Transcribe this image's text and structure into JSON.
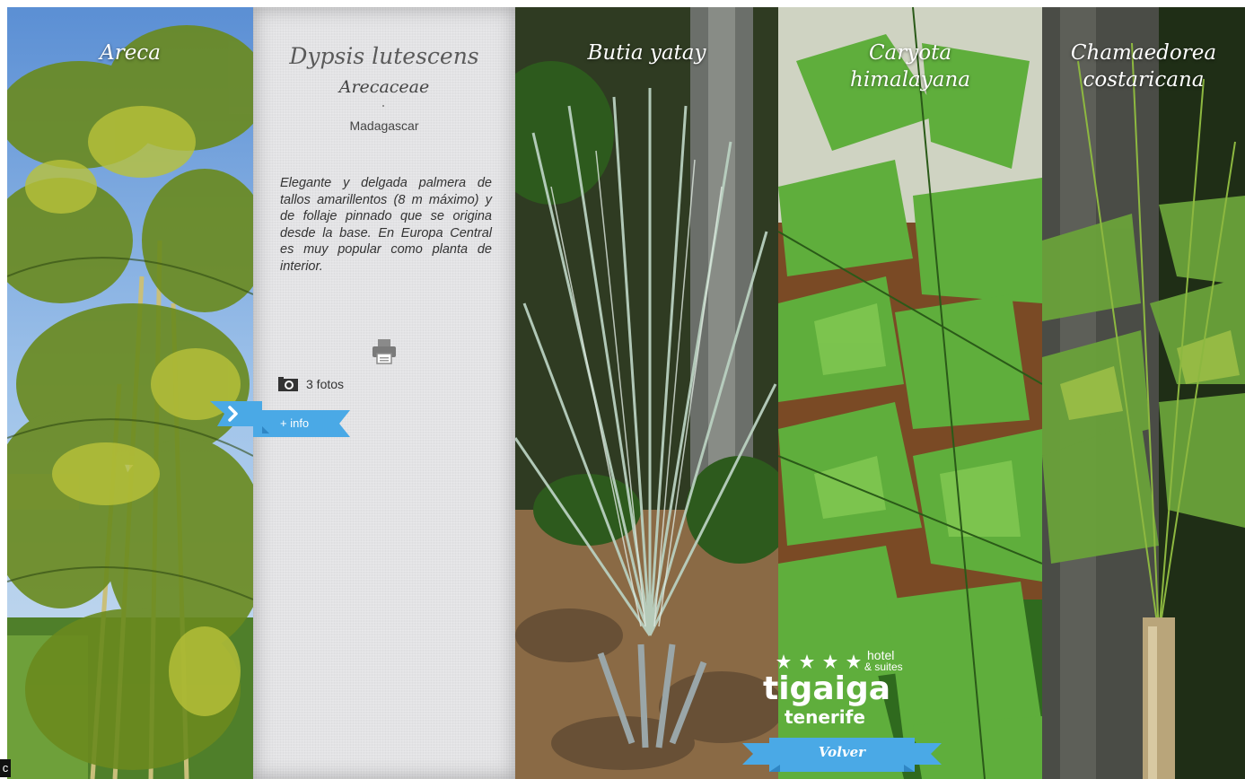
{
  "panels": [
    {
      "title": "Areca"
    },
    {
      "title": "Butia yatay"
    },
    {
      "title": "Caryota himalayana"
    },
    {
      "title": "Chamaedorea costaricana"
    }
  ],
  "card": {
    "scientific_name": "Dypsis lutescens",
    "family": "Arecaceae",
    "origin": "Madagascar",
    "description": "Elegante y delgada palmera de tallos amarillentos (8 m máximo) y de follaje pinnado que se origina desde la base. En Europa Central es muy popular como planta de interior.",
    "photos_count": "3 fotos",
    "more_info": "+ info"
  },
  "logo": {
    "text_hotel": "hotel",
    "text_suites": "& suites",
    "text_brand": "tigaiga",
    "text_place": "tenerife"
  },
  "volver_label": "Volver",
  "corner_label": "c",
  "icons": {
    "printer": "printer-icon",
    "camera": "camera-icon",
    "arrow": "chevron-right-icon"
  },
  "colors": {
    "ribbon": "#4aa9e6",
    "ribbon_dark": "#2f86c4",
    "card_bg": "#e3e3e5"
  }
}
